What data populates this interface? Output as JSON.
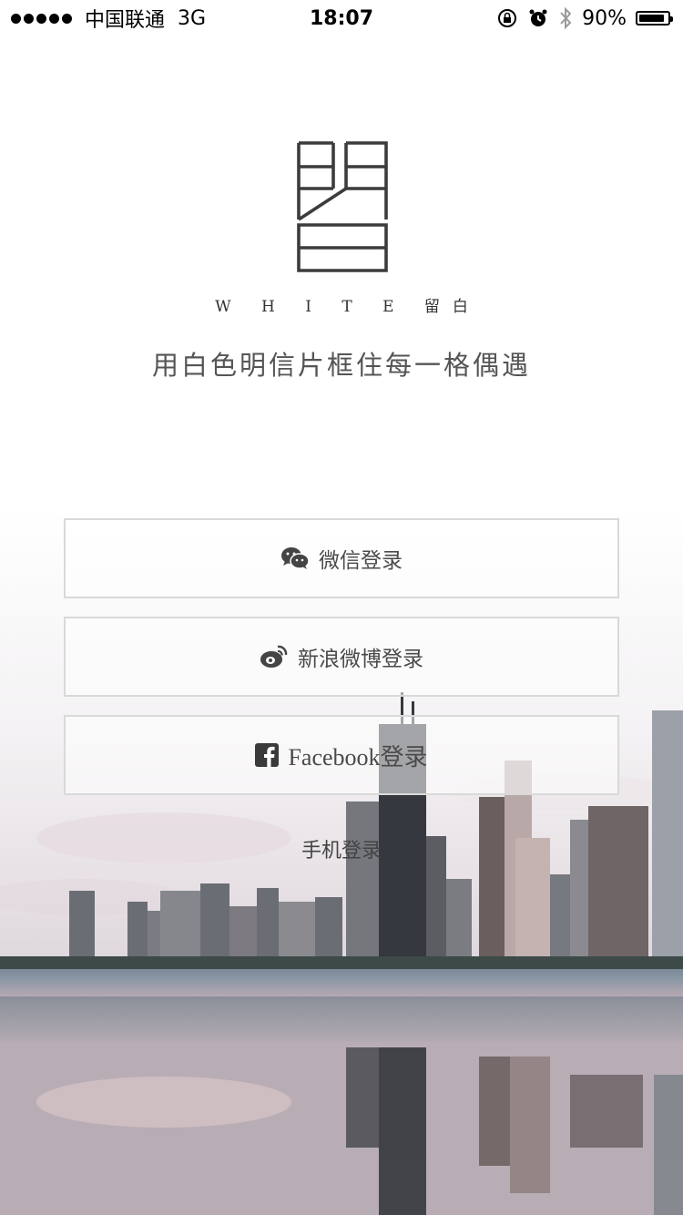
{
  "status_bar": {
    "carrier": "中国联通",
    "network": "3G",
    "time": "18:07",
    "battery_percent": "90%",
    "battery_level": 0.9,
    "icons": [
      "signal-dots-icon",
      "orientation-lock-icon",
      "alarm-icon",
      "bluetooth-icon",
      "battery-icon"
    ]
  },
  "brand": {
    "name": "W H I T E 留白",
    "tagline": "用白色明信片框住每一格偶遇"
  },
  "login": {
    "wechat_label": "微信登录",
    "weibo_label": "新浪微博登录",
    "facebook_label": "Facebook登录",
    "phone_label": "手机登录",
    "icons": [
      "wechat-icon",
      "weibo-icon",
      "facebook-icon"
    ]
  },
  "colors": {
    "text": "#4a4a4a",
    "button_border": "#d9d9d9",
    "logo": "#3c3c3c"
  }
}
